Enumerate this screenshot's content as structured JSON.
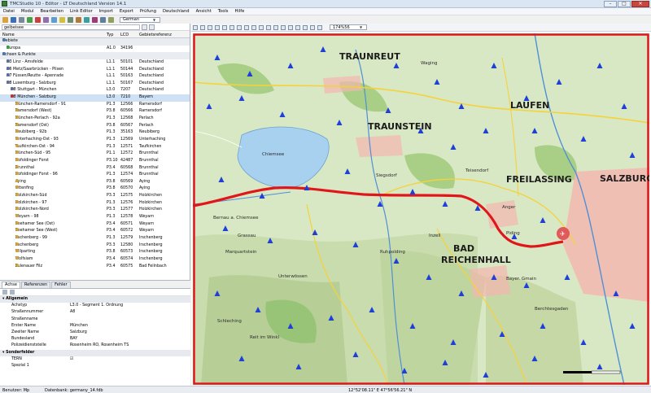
{
  "window": {
    "title": "TMCStudio 10 - Editor - LT Deutschland Version 14.1"
  },
  "menu": [
    "Datei",
    "Modul",
    "Bearbeiten",
    "Link Editor",
    "Import",
    "Export",
    "Prüfung",
    "Deutschland",
    "Ansicht",
    "Tools",
    "Hilfe"
  ],
  "toolbar": {
    "language": "German",
    "scale": "174%56"
  },
  "search": {
    "value": "gelbeisee"
  },
  "tree": {
    "columns": {
      "name": "Name",
      "typ": "Typ",
      "lcd": "LCD",
      "gebiet": "Gebietsreferenz"
    },
    "rows": [
      {
        "indent": 0,
        "name": "Gebiete",
        "typ": "",
        "lcd": "",
        "geb": "",
        "kind": "grp"
      },
      {
        "indent": 2,
        "name": "Europa",
        "typ": "A1.0",
        "lcd": "34196",
        "geb": "",
        "kind": "g"
      },
      {
        "indent": 0,
        "name": "Achsen & Punkte",
        "typ": "",
        "lcd": "",
        "geb": "",
        "kind": "grp"
      },
      {
        "indent": 2,
        "name": "A3 Linz - Amsfelde",
        "typ": "L1.1",
        "lcd": "50101",
        "geb": "Deutschland",
        "kind": "l"
      },
      {
        "indent": 2,
        "name": "A6 Metz/Saarbrücken - Pilsen",
        "typ": "L1.1",
        "lcd": "50144",
        "geb": "Deutschland",
        "kind": "l"
      },
      {
        "indent": 2,
        "name": "A7 Füssen/Reutte - Apenrade",
        "typ": "L1.1",
        "lcd": "50163",
        "geb": "Deutschland",
        "kind": "l"
      },
      {
        "indent": 2,
        "name": "A8 Luxemburg - Salzburg",
        "typ": "L1.1",
        "lcd": "50167",
        "geb": "Deutschland",
        "kind": "l"
      },
      {
        "indent": 4,
        "name": "A8 Stuttgart - München",
        "typ": "L3.0",
        "lcd": "7207",
        "geb": "Deutschland",
        "kind": "l"
      },
      {
        "indent": 4,
        "name": "A8 München - Salzburg",
        "typ": "L3.0",
        "lcd": "7210",
        "geb": "Bayern",
        "kind": "sel"
      },
      {
        "indent": 6,
        "name": "München-Ramersdorf - 91",
        "typ": "P1.3",
        "lcd": "12566",
        "geb": "Ramersdorf",
        "kind": "p"
      },
      {
        "indent": 6,
        "name": "Ramersdorf (West)",
        "typ": "P3.8",
        "lcd": "60566",
        "geb": "Ramersdorf",
        "kind": "p"
      },
      {
        "indent": 6,
        "name": "München-Perlach - 92a",
        "typ": "P1.3",
        "lcd": "12568",
        "geb": "Perlach",
        "kind": "p"
      },
      {
        "indent": 6,
        "name": "Ramersdorf (Ost)",
        "typ": "P3.8",
        "lcd": "60567",
        "geb": "Perlach",
        "kind": "p"
      },
      {
        "indent": 6,
        "name": "Neubiberg - 92b",
        "typ": "P1.3",
        "lcd": "35163",
        "geb": "Neubiberg",
        "kind": "p"
      },
      {
        "indent": 6,
        "name": "Unterhaching-Ost - 93",
        "typ": "P1.3",
        "lcd": "12569",
        "geb": "Unterhaching",
        "kind": "p"
      },
      {
        "indent": 6,
        "name": "Taufkirchen-Ost - 94",
        "typ": "P1.3",
        "lcd": "12571",
        "geb": "Taufkirchen",
        "kind": "p"
      },
      {
        "indent": 6,
        "name": "München-Süd - 95",
        "typ": "P1.1",
        "lcd": "12572",
        "geb": "Brunnthal",
        "kind": "p"
      },
      {
        "indent": 6,
        "name": "Hofoldinger Forst",
        "typ": "P3.10",
        "lcd": "42487",
        "geb": "Brunnthal",
        "kind": "p"
      },
      {
        "indent": 6,
        "name": "Brunnthal",
        "typ": "P3.4",
        "lcd": "60568",
        "geb": "Brunnthal",
        "kind": "p"
      },
      {
        "indent": 6,
        "name": "Hofoldinger Forst - 96",
        "typ": "P1.3",
        "lcd": "12574",
        "geb": "Brunnthal",
        "kind": "p"
      },
      {
        "indent": 6,
        "name": "Aying",
        "typ": "P3.8",
        "lcd": "60569",
        "geb": "Aying",
        "kind": "p"
      },
      {
        "indent": 6,
        "name": "Ottenfing",
        "typ": "P3.8",
        "lcd": "60570",
        "geb": "Aying",
        "kind": "p"
      },
      {
        "indent": 6,
        "name": "Holzkirchen-Süd",
        "typ": "P3.3",
        "lcd": "12575",
        "geb": "Holzkirchen",
        "kind": "p"
      },
      {
        "indent": 6,
        "name": "Holzkirchen - 97",
        "typ": "P1.3",
        "lcd": "12576",
        "geb": "Holzkirchen",
        "kind": "p"
      },
      {
        "indent": 6,
        "name": "Holzkirchen-Nord",
        "typ": "P3.3",
        "lcd": "12577",
        "geb": "Holzkirchen",
        "kind": "p"
      },
      {
        "indent": 6,
        "name": "Weyarn - 98",
        "typ": "P1.3",
        "lcd": "12578",
        "geb": "Weyarn",
        "kind": "p"
      },
      {
        "indent": 6,
        "name": "Seehamer See (Ost)",
        "typ": "P3.4",
        "lcd": "60571",
        "geb": "Weyarn",
        "kind": "p"
      },
      {
        "indent": 6,
        "name": "Seehamer See (West)",
        "typ": "P3.4",
        "lcd": "60572",
        "geb": "Weyarn",
        "kind": "p"
      },
      {
        "indent": 6,
        "name": "Irschenberg - 99",
        "typ": "P1.3",
        "lcd": "12579",
        "geb": "Irschenberg",
        "kind": "p"
      },
      {
        "indent": 6,
        "name": "Irschenberg",
        "typ": "P3.3",
        "lcd": "12580",
        "geb": "Irschenberg",
        "kind": "p"
      },
      {
        "indent": 6,
        "name": "Wilparting",
        "typ": "P3.8",
        "lcd": "60573",
        "geb": "Irschenberg",
        "kind": "p"
      },
      {
        "indent": 6,
        "name": "Wolfsiam",
        "typ": "P3.4",
        "lcd": "60574",
        "geb": "Irschenberg",
        "kind": "p"
      },
      {
        "indent": 6,
        "name": "Eulenauer Filz",
        "typ": "P3.4",
        "lcd": "60575",
        "geb": "Bad Feilnbach",
        "kind": "p"
      }
    ]
  },
  "tabs": [
    "Achse",
    "Referenzen",
    "Fehler"
  ],
  "properties": [
    {
      "k": "Allgemein",
      "v": "",
      "cat": true
    },
    {
      "k": "Achstyp",
      "v": "L3.0 - Segment 1. Ordnung",
      "cat": false
    },
    {
      "k": "Straßennummer",
      "v": "A8",
      "cat": false
    },
    {
      "k": "Straßenname",
      "v": "",
      "cat": false
    },
    {
      "k": "Erster Name",
      "v": "München",
      "cat": false
    },
    {
      "k": "Zweiter Name",
      "v": "Salzburg",
      "cat": false
    },
    {
      "k": "Bundesland",
      "v": "BAY",
      "cat": false
    },
    {
      "k": "Polizeidienststelle",
      "v": "Rosenheim RO, Rosenheim TS",
      "cat": false
    },
    {
      "k": "Sonderfelder",
      "v": "",
      "cat": true
    },
    {
      "k": "TERN",
      "v": "☑",
      "cat": false
    },
    {
      "k": "Spezial 1",
      "v": "",
      "cat": false
    }
  ],
  "map": {
    "labels": [
      {
        "t": "TRAUNREUT",
        "big": true
      },
      {
        "t": "TRAUNSTEIN",
        "big": true
      },
      {
        "t": "FREILASSING",
        "big": true
      },
      {
        "t": "SALZBURG",
        "big": true
      },
      {
        "t": "LAUFEN",
        "big": true
      },
      {
        "t": "BAD",
        "big": true
      },
      {
        "t": "REICHENHALL",
        "big": true
      },
      {
        "t": "Chiemsee",
        "big": false
      },
      {
        "t": "Siegsdorf",
        "big": false
      },
      {
        "t": "Bernau a. Chiemsee",
        "big": false
      },
      {
        "t": "Grassau",
        "big": false
      },
      {
        "t": "Marquartstein",
        "big": false
      },
      {
        "t": "Unterwössen",
        "big": false
      },
      {
        "t": "Ruhpolding",
        "big": false
      },
      {
        "t": "Inzell",
        "big": false
      },
      {
        "t": "Piding",
        "big": false
      },
      {
        "t": "Anger",
        "big": false
      },
      {
        "t": "Teisendorf",
        "big": false
      },
      {
        "t": "Waging",
        "big": false
      },
      {
        "t": "Schleching",
        "big": false
      },
      {
        "t": "Reit im Winkl",
        "big": false
      },
      {
        "t": "Bayer. Gmain",
        "big": false
      },
      {
        "t": "Berchtesgaden",
        "big": false
      }
    ],
    "route_color": "#e0161a",
    "frame_color": "#e0161a"
  },
  "status": {
    "user": "Benutzer: Mp",
    "db": "Datenbank: germany_14.fdb",
    "coords": "12°52'08.11\" E  47°56'56.21\" N"
  }
}
